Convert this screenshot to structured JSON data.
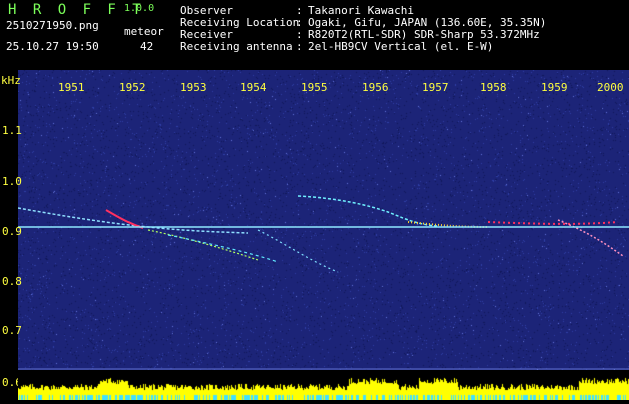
{
  "header": {
    "app_title": "H R O F F T",
    "app_version": "1.0.0",
    "file_name": "2510271950.png",
    "timestamp": "25.10.27 19:50",
    "meteor_label": "meteor",
    "meteor_count": "42"
  },
  "info": [
    {
      "label": "Observer",
      "value": "Takanori Kawachi"
    },
    {
      "label": "Receiving Location",
      "value": "Ogaki, Gifu, JAPAN (136.60E, 35.35N)"
    },
    {
      "label": "Receiver",
      "value": "R820T2(RTL-SDR) SDR-Sharp 53.372MHz"
    },
    {
      "label": "Receiving antenna",
      "value": "2el-HB9CV Vertical (el. E-W)"
    }
  ],
  "separator": ":",
  "spectrogram": {
    "unit": "kHz",
    "x_ticks": [
      "1951",
      "1952",
      "1953",
      "1954",
      "1955",
      "1956",
      "1957",
      "1958",
      "1959",
      "2000"
    ],
    "y_ticks": [
      "1.1",
      "1.0",
      "0.9",
      "0.8",
      "0.7",
      "0.6"
    ],
    "x_range": [
      1950,
      2000
    ],
    "y_range": [
      0.6,
      1.2
    ],
    "carrier_khz": 0.905,
    "colors": {
      "background": "#1c2478",
      "tick_text": "#ffff40",
      "carrier": "#8ee8ff",
      "trace": "#8fe0ff",
      "hot": "#ff3060",
      "bar_yellow": "#ffff00",
      "bar_cyan": "#40e0ff"
    }
  }
}
